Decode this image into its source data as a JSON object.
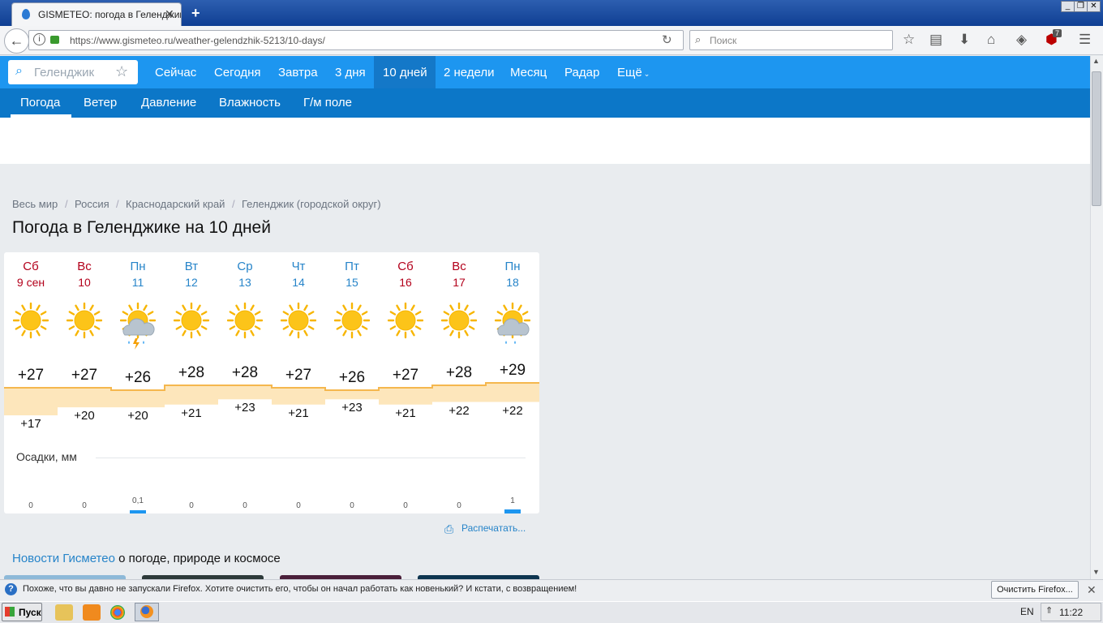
{
  "browser": {
    "tab_title": "GISMETEO: погода в Геленджик",
    "url": "https://www.gismeteo.ru/weather-gelendzhik-5213/10-days/",
    "search_placeholder": "Поиск",
    "ublock_count": "7"
  },
  "site": {
    "search_value": "Геленджик",
    "nav": [
      "Сейчас",
      "Сегодня",
      "Завтра",
      "3 дня",
      "10 дней",
      "2 недели",
      "Месяц",
      "Радар",
      "Ещё"
    ],
    "nav_active": "10 дней",
    "subnav": [
      "Погода",
      "Ветер",
      "Давление",
      "Влажность",
      "Г/м поле"
    ],
    "subnav_active": "Погода",
    "accent": "#1d96f0"
  },
  "breadcrumb": [
    "Весь мир",
    "Россия",
    "Краснодарский край",
    "Геленджик (городской округ)"
  ],
  "page_title": "Погода в Геленджике на 10 дней",
  "forecast": {
    "days": [
      {
        "name": "Сб",
        "date": "9 сен",
        "weekend": true,
        "icon": "sun-icon",
        "max": "+27",
        "min": "+17",
        "precip": "0"
      },
      {
        "name": "Вс",
        "date": "10",
        "weekend": true,
        "icon": "sun-icon",
        "max": "+27",
        "min": "+20",
        "precip": "0"
      },
      {
        "name": "Пн",
        "date": "11",
        "weekend": false,
        "icon": "thunderstorm-icon",
        "max": "+26",
        "min": "+20",
        "precip": "0,1"
      },
      {
        "name": "Вт",
        "date": "12",
        "weekend": false,
        "icon": "sun-icon",
        "max": "+28",
        "min": "+21",
        "precip": "0"
      },
      {
        "name": "Ср",
        "date": "13",
        "weekend": false,
        "icon": "sun-icon",
        "max": "+28",
        "min": "+23",
        "precip": "0"
      },
      {
        "name": "Чт",
        "date": "14",
        "weekend": false,
        "icon": "sun-icon",
        "max": "+27",
        "min": "+21",
        "precip": "0"
      },
      {
        "name": "Пт",
        "date": "15",
        "weekend": false,
        "icon": "sun-icon",
        "max": "+26",
        "min": "+23",
        "precip": "0"
      },
      {
        "name": "Сб",
        "date": "16",
        "weekend": true,
        "icon": "sun-icon",
        "max": "+27",
        "min": "+21",
        "precip": "0"
      },
      {
        "name": "Вс",
        "date": "17",
        "weekend": true,
        "icon": "sun-icon",
        "max": "+28",
        "min": "+22",
        "precip": "0"
      },
      {
        "name": "Пн",
        "date": "18",
        "weekend": false,
        "icon": "rain-icon",
        "max": "+29",
        "min": "+22",
        "precip": "1"
      }
    ],
    "precip_label": "Осадки, мм",
    "print_label": "Распечатать..."
  },
  "news": {
    "link": "Новости Гисметео",
    "rest": " о погоде, природе и космосе"
  },
  "notification": {
    "text": "Похоже, что вы давно не запускали Firefox. Хотите очистить его, чтобы он начал работать как новенький? И кстати, с возвращением!",
    "button": "Очистить Firefox..."
  },
  "taskbar": {
    "start": "Пуск",
    "lang": "EN",
    "clock": "11:22"
  }
}
